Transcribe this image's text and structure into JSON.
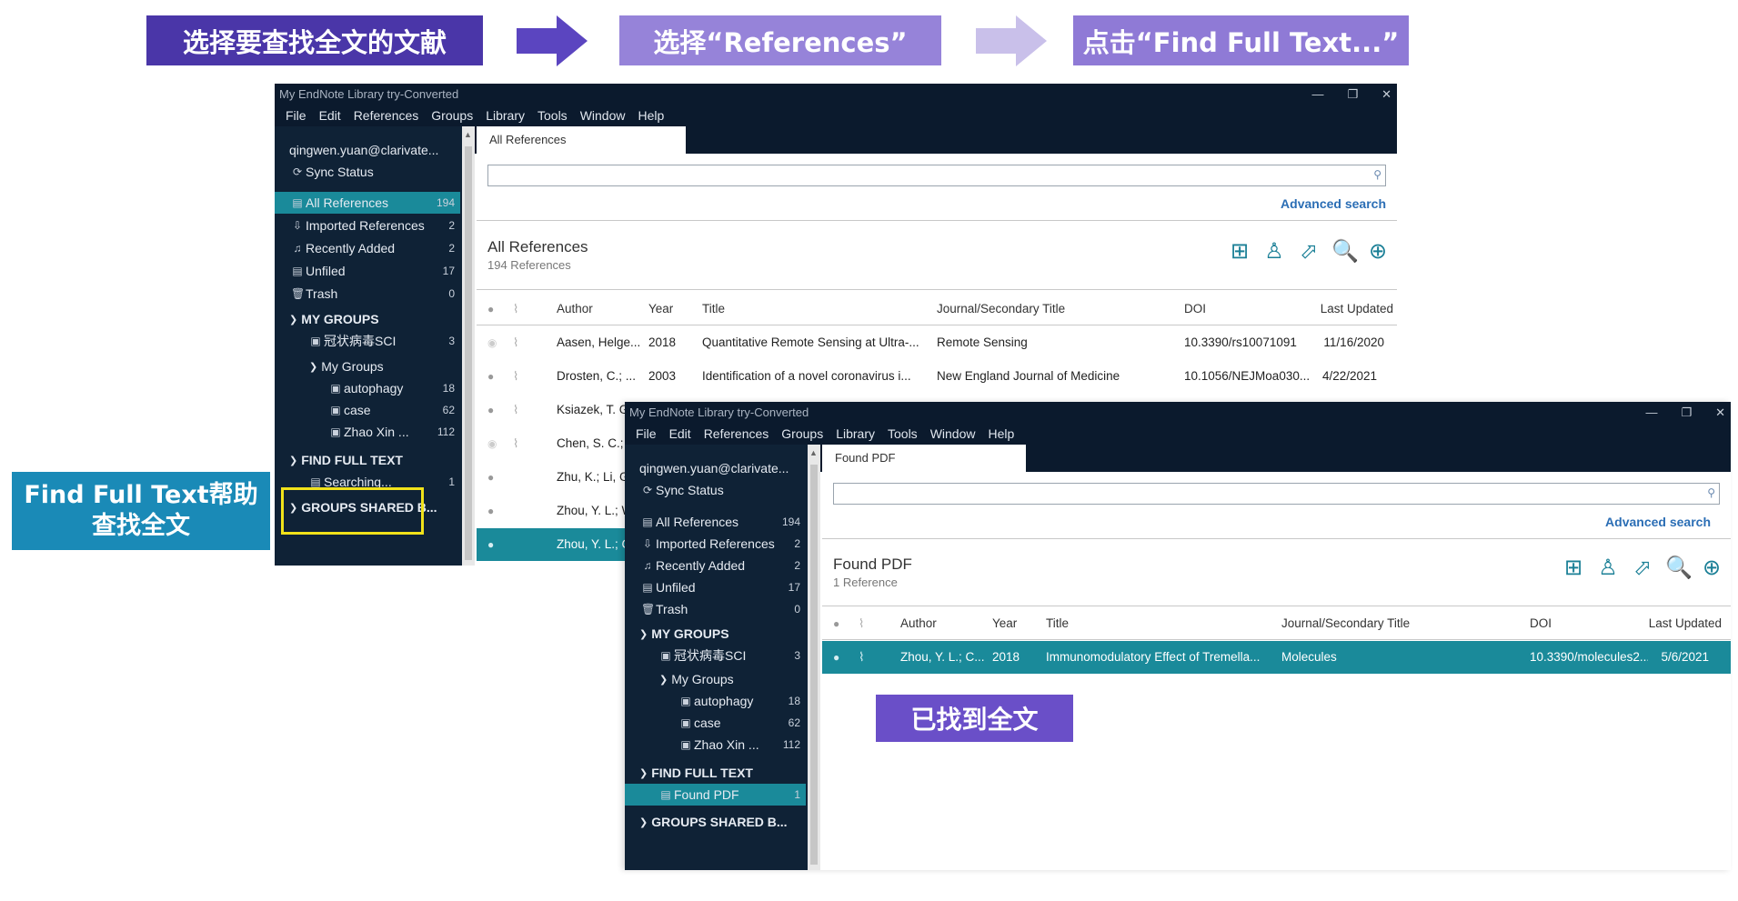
{
  "steps": {
    "step1": "选择要查找全文的文献",
    "step2": "选择“References”",
    "step3": "点击“Find Full Text...”"
  },
  "callouts": {
    "fft_line1": "Find Full Text帮助",
    "fft_line2": "查找全文",
    "found": "已找到全文"
  },
  "colors": {
    "accent_teal": "#1a8a9a",
    "sidebar_bg": "#0f2236",
    "step_dark": "#4a36a8",
    "step_light": "#9683d9",
    "highlight_yellow": "#f1e21a"
  },
  "window1": {
    "title": "My EndNote Library try-Converted",
    "menu": [
      "File",
      "Edit",
      "References",
      "Groups",
      "Library",
      "Tools",
      "Window",
      "Help"
    ],
    "tab": "All References",
    "advanced_search": "Advanced search",
    "group_title": "All References",
    "group_count": "194 References",
    "sidebar": {
      "account": "qingwen.yuan@clarivate...",
      "sync": "Sync Status",
      "items": [
        {
          "label": "All References",
          "count": "194"
        },
        {
          "label": "Imported References",
          "count": "2"
        },
        {
          "label": "Recently Added",
          "count": "2"
        },
        {
          "label": "Unfiled",
          "count": "17"
        },
        {
          "label": "Trash",
          "count": "0"
        }
      ],
      "my_groups_header": "MY GROUPS",
      "group_covid": {
        "label": "冠状病毒SCI",
        "count": "3"
      },
      "my_groups_sub": "My Groups",
      "subgroups": [
        {
          "label": "autophagy",
          "count": "18"
        },
        {
          "label": "case",
          "count": "62"
        },
        {
          "label": "Zhao Xin ...",
          "count": "112"
        }
      ],
      "fft_header": "FIND FULL TEXT",
      "fft_item": {
        "label": "Searching...",
        "count": "1"
      },
      "shared_header": "GROUPS SHARED B..."
    },
    "columns": [
      "Author",
      "Year",
      "Title",
      "Journal/Secondary Title",
      "DOI",
      "Last Updated"
    ],
    "rows": [
      {
        "author": "Aasen, Helge...",
        "year": "2018",
        "title": "Quantitative Remote Sensing at Ultra-...",
        "journal": "Remote Sensing",
        "doi": "10.3390/rs10071091",
        "updated": "11/16/2020"
      },
      {
        "author": "Drosten, C.; ...",
        "year": "2003",
        "title": "Identification of a novel coronavirus i...",
        "journal": "New England Journal of Medicine",
        "doi": "10.1056/NEJMoa030...",
        "updated": "4/22/2021"
      },
      {
        "author": "Ksiazek, T. G",
        "year": "",
        "title": "",
        "journal": "",
        "doi": "",
        "updated": ""
      },
      {
        "author": "Chen, S. C.; Z",
        "year": "",
        "title": "",
        "journal": "",
        "doi": "",
        "updated": ""
      },
      {
        "author": "Zhu, K.; Li, G.",
        "year": "",
        "title": "",
        "journal": "",
        "doi": "",
        "updated": ""
      },
      {
        "author": "Zhou, Y. L.; W",
        "year": "",
        "title": "",
        "journal": "",
        "doi": "",
        "updated": ""
      },
      {
        "author": "Zhou, Y. L.; C",
        "year": "",
        "title": "",
        "journal": "",
        "doi": "",
        "updated": ""
      }
    ]
  },
  "window2": {
    "title": "My EndNote Library try-Converted",
    "menu": [
      "File",
      "Edit",
      "References",
      "Groups",
      "Library",
      "Tools",
      "Window",
      "Help"
    ],
    "tab": "Found PDF",
    "advanced_search": "Advanced search",
    "group_title": "Found PDF",
    "group_count": "1 Reference",
    "sidebar": {
      "account": "qingwen.yuan@clarivate...",
      "sync": "Sync Status",
      "items": [
        {
          "label": "All References",
          "count": "194"
        },
        {
          "label": "Imported References",
          "count": "2"
        },
        {
          "label": "Recently Added",
          "count": "2"
        },
        {
          "label": "Unfiled",
          "count": "17"
        },
        {
          "label": "Trash",
          "count": "0"
        }
      ],
      "my_groups_header": "MY GROUPS",
      "group_covid": {
        "label": "冠状病毒SCI",
        "count": "3"
      },
      "my_groups_sub": "My Groups",
      "subgroups": [
        {
          "label": "autophagy",
          "count": "18"
        },
        {
          "label": "case",
          "count": "62"
        },
        {
          "label": "Zhao Xin ...",
          "count": "112"
        }
      ],
      "fft_header": "FIND FULL TEXT",
      "fft_item": {
        "label": "Found PDF",
        "count": "1"
      },
      "shared_header": "GROUPS SHARED B..."
    },
    "columns": [
      "Author",
      "Year",
      "Title",
      "Journal/Secondary Title",
      "DOI",
      "Last Updated"
    ],
    "rows": [
      {
        "author": "Zhou, Y. L.; C...",
        "year": "2018",
        "title": "Immunomodulatory Effect of Tremella...",
        "journal": "Molecules",
        "doi": "10.3390/molecules2...",
        "updated": "5/6/2021"
      }
    ]
  }
}
